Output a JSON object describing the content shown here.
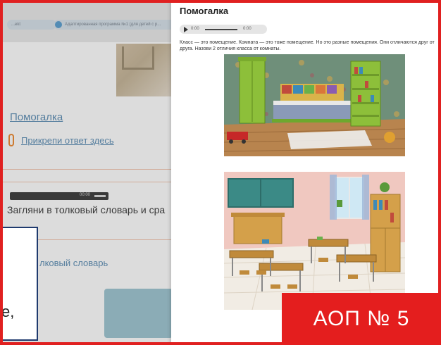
{
  "background_page": {
    "tab_left": "...ekt",
    "tab_right": "Адаптированная программа №1 (для детей с р...",
    "link_pomogalka": "Помогалка",
    "link_attach": "Прикрепи ответ здесь",
    "player_time": "00:00",
    "instruction_text": "Загляни в толковый словарь и сра",
    "link_dictionary": "лковый словарь",
    "card_text": "е,"
  },
  "popup": {
    "title": "Помогалка",
    "audio": {
      "current": "0:00",
      "duration": "0:00"
    },
    "description": "Класс — это помещение. Комната — это тоже помещение. Но это разные помещения. Они отличаются друг от друга. Назови 2 отличия класса от комнаты."
  },
  "badge": {
    "text": "АОП № 5"
  },
  "colors": {
    "frame": "#e02020",
    "badge": "#e41e1e",
    "link": "#4e7fa6",
    "card_border": "#1f3a6e"
  }
}
